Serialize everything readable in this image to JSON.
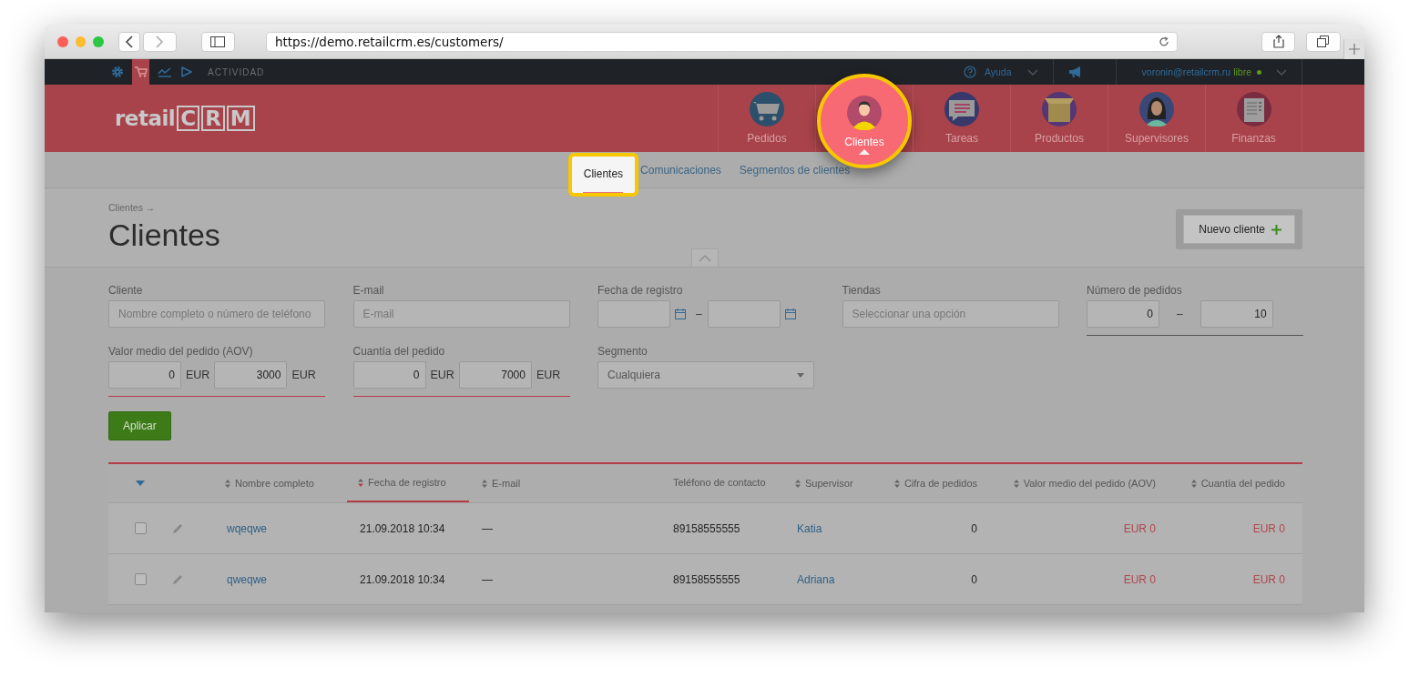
{
  "browser": {
    "url": "https://demo.retailcrm.es/customers/"
  },
  "topbar": {
    "section": "ACTIVIDAD",
    "help": "Ayuda",
    "user": "voronin@retailcrm.ru",
    "plan": "libre"
  },
  "logo": {
    "prefix": "retail",
    "letters": [
      "C",
      "R",
      "M"
    ]
  },
  "nav": {
    "items": [
      {
        "label": "Pedidos",
        "selected": false,
        "spotlight": false
      },
      {
        "label": "Clientes",
        "selected": true,
        "spotlight": true
      },
      {
        "label": "Tareas",
        "selected": false,
        "spotlight": false
      },
      {
        "label": "Productos",
        "selected": false,
        "spotlight": false
      },
      {
        "label": "Supervisores",
        "selected": false,
        "spotlight": false
      },
      {
        "label": "Finanzas",
        "selected": false,
        "spotlight": false
      }
    ]
  },
  "subnav": {
    "items": [
      {
        "label": "Clientes",
        "selected": true,
        "spotlight": true
      },
      {
        "label": "Comunicaciones",
        "selected": false,
        "spotlight": false
      },
      {
        "label": "Segmentos de clientes",
        "selected": false,
        "spotlight": false
      }
    ]
  },
  "page": {
    "breadcrumb": "Clientes →",
    "title": "Clientes",
    "new_button": "Nuevo cliente"
  },
  "filters": [
    {
      "kind": "text",
      "label": "Cliente",
      "placeholder": "Nombre completo o número de teléfono"
    },
    {
      "kind": "text",
      "label": "E-mail",
      "placeholder": "E-mail"
    },
    {
      "kind": "date_range",
      "label": "Fecha de registro",
      "separator": "–"
    },
    {
      "kind": "text",
      "label": "Tiendas",
      "placeholder": "Seleccionar una opción"
    },
    {
      "kind": "number_range",
      "label": "Número de pedidos",
      "from": "0",
      "to": "10",
      "separator": "–"
    },
    {
      "kind": "number_range",
      "label": "Valor medio del pedido (AOV)",
      "from": "0",
      "to": "3000",
      "from_unit": "EUR",
      "to_unit": "EUR"
    },
    {
      "kind": "number_range",
      "label": "Cuantía del pedido",
      "from": "0",
      "to": "7000",
      "from_unit": "EUR",
      "to_unit": "EUR"
    },
    {
      "kind": "select",
      "label": "Segmento",
      "value": "Cualquiera"
    }
  ],
  "apply_button": "Aplicar",
  "table": {
    "columns": [
      {
        "label": "Nombre completo",
        "sorted": false
      },
      {
        "label": "Fecha de registro",
        "sorted": true
      },
      {
        "label": "E-mail",
        "sorted": false
      },
      {
        "label": "Teléfono de contacto",
        "sortable": false,
        "sorted": false
      },
      {
        "label": "Supervisor",
        "sorted": false
      },
      {
        "label": "Cifra de pedidos",
        "sorted": false
      },
      {
        "label": "Valor medio del pedido (AOV)",
        "sorted": false
      },
      {
        "label": "Cuantía del pedido",
        "sorted": false
      }
    ],
    "rows": [
      {
        "checked": false,
        "cells": [
          "wqeqwe",
          "21.09.2018 10:34",
          "—",
          "89158555555",
          "Katia",
          "0",
          "EUR 0",
          "EUR 0"
        ]
      },
      {
        "checked": false,
        "cells": [
          "qweqwe",
          "21.09.2018 10:34",
          "—",
          "89158555555",
          "Adriana",
          "0",
          "EUR 0",
          "EUR 0"
        ]
      }
    ]
  }
}
